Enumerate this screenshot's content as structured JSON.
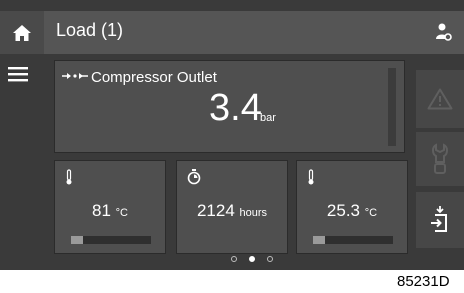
{
  "header": {
    "title": "Load (1)",
    "home_icon": "home-icon",
    "user_icon": "user-settings-icon"
  },
  "sidebar": {
    "menu_icon": "hamburger-menu-icon"
  },
  "main_card": {
    "icon": "compressor-outlet-icon",
    "label": "Compressor Outlet",
    "value": "3.4",
    "unit": "bar"
  },
  "cards": [
    {
      "icon": "thermometer-icon",
      "value": "81",
      "unit": "°C",
      "level": 0.15
    },
    {
      "icon": "timer-icon",
      "value": "2124",
      "unit": "hours"
    },
    {
      "icon": "thermometer-icon",
      "value": "25.3",
      "unit": "°C",
      "level": 0.15
    }
  ],
  "side_buttons": [
    {
      "icon": "warning-triangle-icon"
    },
    {
      "icon": "service-wrench-icon"
    },
    {
      "icon": "input-panel-icon"
    }
  ],
  "pagination": {
    "pages": 3,
    "active": 1
  },
  "figure_id": "85231D",
  "colors": {
    "background": "#3a3a3a",
    "bar": "#555555",
    "card": "#4f4f4f",
    "text": "#ffffff"
  }
}
